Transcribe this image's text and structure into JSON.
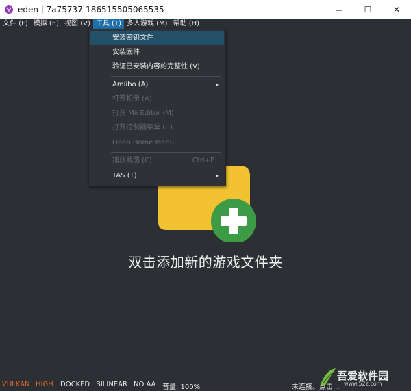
{
  "window": {
    "title": "eden | 7a75737-186515505065535",
    "controls": {
      "minimize": "—",
      "maximize": "☐",
      "close": "✕"
    }
  },
  "menubar": {
    "items": [
      "文件 (F)",
      "模拟 (E)",
      "视图 (V)",
      "工具 (T)",
      "多人游戏 (M)",
      "帮助 (H)"
    ],
    "active_index": 3
  },
  "tools_menu": {
    "items": [
      {
        "label": "安装密钥文件",
        "highlighted": true
      },
      {
        "label": "安装固件"
      },
      {
        "label": "验证已安装内容的完整性 (V)"
      },
      {
        "label": "Amiibo (A)",
        "submenu": "▸"
      },
      {
        "label": "打开相册 (A)",
        "disabled": true
      },
      {
        "label": "打开 Mii Editor (M)",
        "disabled": true
      },
      {
        "label": "打开控制器菜单 (C)",
        "disabled": true
      },
      {
        "label": "Open Home Menu",
        "disabled": true
      },
      {
        "label": "捕获截图 (C)",
        "shortcut": "Ctrl+P",
        "disabled": true
      },
      {
        "label": "TAS (T)",
        "submenu": "▸"
      }
    ]
  },
  "main": {
    "empty_message": "双击添加新的游戏文件夹",
    "folder_color": "#f2c232",
    "plus_color": "#3d9b45"
  },
  "statusbar": {
    "vulkan": "VULKAN",
    "high": "HIGH",
    "docked": "DOCKED",
    "bilinear": "BILINEAR",
    "no_aa": "NO AA",
    "volume": "音量: 100%",
    "connection": "未连接。点击..."
  },
  "colors": {
    "vulkan": "#e36a2a",
    "high": "#e36a2a",
    "accent": "#1f6fa8"
  },
  "watermark": {
    "text": "吾爱软件园",
    "url": "www.52z.com"
  }
}
